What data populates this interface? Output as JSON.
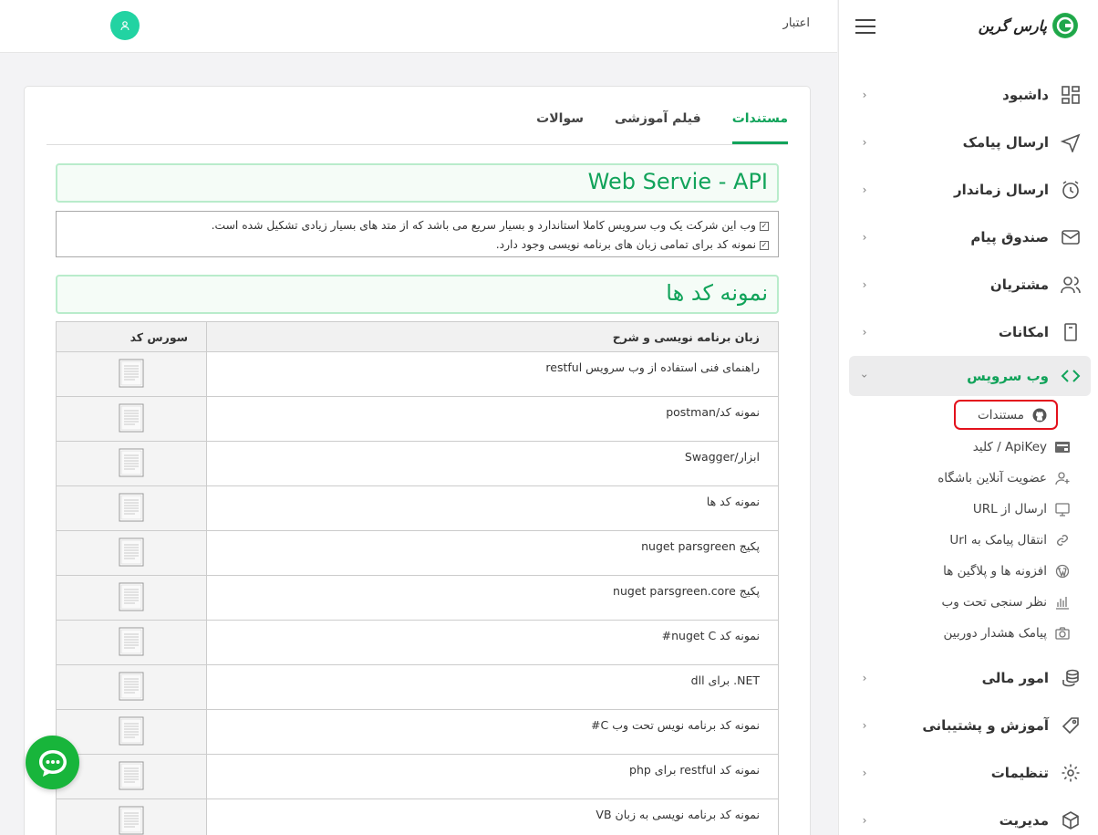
{
  "brand": {
    "name": "پارس گرین"
  },
  "topbar": {
    "credit_label": "اعتبار"
  },
  "sidebar": {
    "items_top": [
      {
        "label": "داشبود",
        "icon": "dashboard-icon"
      },
      {
        "label": "ارسال پیامک",
        "icon": "send-icon"
      },
      {
        "label": "ارسال زماندار",
        "icon": "alarm-clock-icon"
      },
      {
        "label": "صندوق پیام",
        "icon": "mail-icon"
      },
      {
        "label": "مشتریان",
        "icon": "users-icon"
      },
      {
        "label": "امکانات",
        "icon": "book-icon"
      }
    ],
    "active": {
      "label": "وب سرویس",
      "icon": "code-icon"
    },
    "submenu": [
      {
        "label": "مستندات",
        "icon": "github-icon"
      },
      {
        "label": "ApiKey / کلید",
        "icon": "key-card-icon"
      },
      {
        "label": "عضویت آنلاین باشگاه",
        "icon": "user-add-icon"
      },
      {
        "label": "ارسال از URL",
        "icon": "monitor-icon"
      },
      {
        "label": "انتقال پیامک به Url",
        "icon": "link-icon"
      },
      {
        "label": "افزونه ها و پلاگین ها",
        "icon": "wordpress-icon"
      },
      {
        "label": "نظر سنجی تحت وب",
        "icon": "bar-chart-icon"
      },
      {
        "label": "پیامک هشدار دوربین",
        "icon": "camera-icon"
      }
    ],
    "items_bottom": [
      {
        "label": "امور مالی",
        "icon": "coins-icon"
      },
      {
        "label": "آموزش و پشتیبانی",
        "icon": "tag-icon"
      },
      {
        "label": "تنظیمات",
        "icon": "gear-icon"
      },
      {
        "label": "مدیریت",
        "icon": "cube-icon"
      }
    ]
  },
  "tabs": [
    "مستندات",
    "فیلم آموزشی",
    "سوالات"
  ],
  "section1": {
    "title": "Web Servie - API",
    "lines": [
      "وب این شرکت یک وب سرویس کاملا استاندارد و بسیار سریع می باشد که از متد های بسیار زیادی تشکیل شده است.",
      "نمونه کد برای تمامی زبان های برنامه نویسی  وجود دارد."
    ]
  },
  "section2": {
    "title": "نمونه کد ها"
  },
  "table": {
    "headers": {
      "desc": "زبان برنامه نویسی و شرح",
      "source": "سورس کد"
    },
    "rows": [
      "راهنمای فنی استفاده از وب سرویس restful",
      "نمونه کد/postman",
      "ابزار/Swagger",
      "نمونه کد ها",
      "پکیج nuget parsgreen",
      "پکیج nuget parsgreen.core",
      "نمونه کد nuget C#",
      "dll برای .NET",
      "نمونه کد برنامه نویس تحت وب C#",
      "نمونه کد restful برای php",
      "نمونه کد برنامه نویسی به زبان VB"
    ]
  },
  "colors": {
    "accent": "#11a35a",
    "highlight": "#e3111c",
    "chat": "#18b53b",
    "avatar": "#22d3a2"
  }
}
